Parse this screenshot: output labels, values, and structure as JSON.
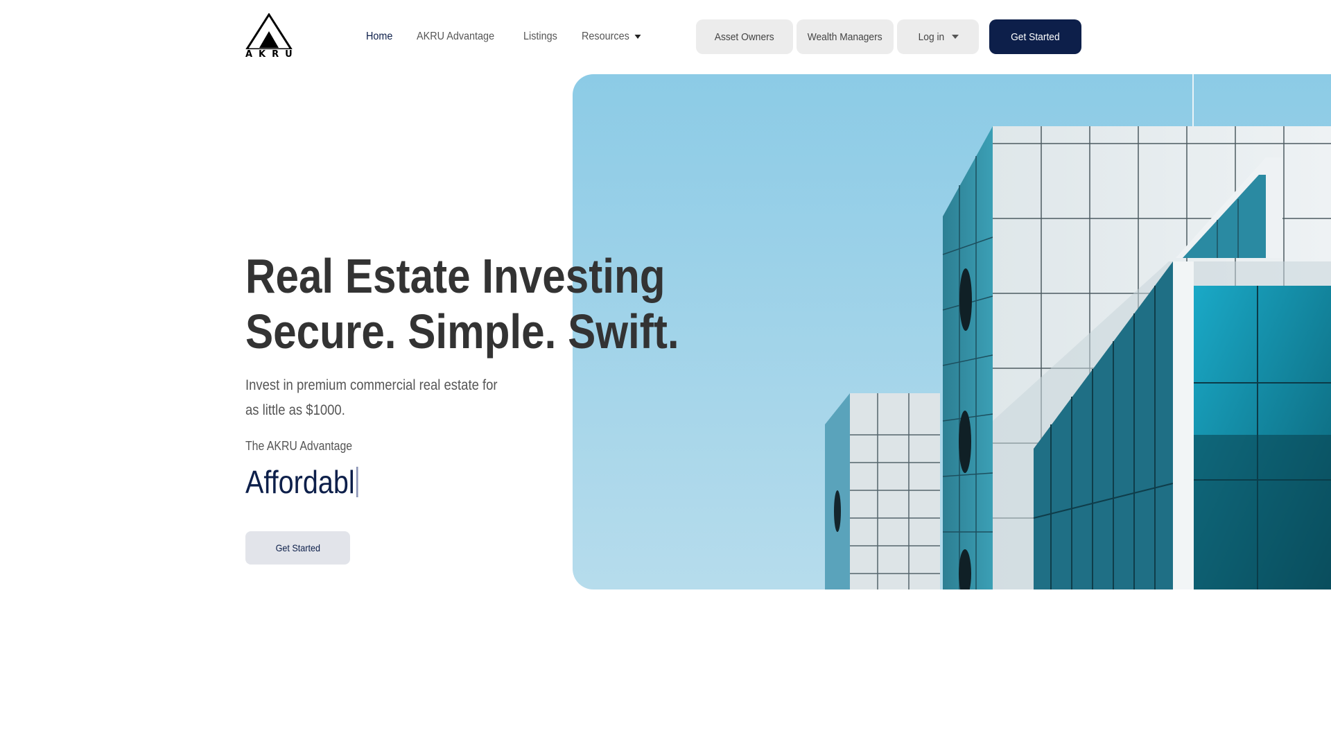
{
  "brand": {
    "name": "AKRU",
    "logo_icon": "triangle-logo-icon"
  },
  "nav": {
    "items": [
      {
        "label": "Home",
        "active": true
      },
      {
        "label": "AKRU Advantage",
        "active": false
      },
      {
        "label": "Listings",
        "active": false
      },
      {
        "label": "Resources",
        "active": false,
        "has_dropdown": true
      }
    ]
  },
  "header_actions": {
    "asset_owners": "Asset Owners",
    "wealth_managers": "Wealth Managers",
    "login": "Log in",
    "get_started": "Get Started"
  },
  "hero": {
    "headline_line1": "Real Estate Investing",
    "headline_line2": "Secure. Simple. Swift.",
    "subcopy": "Invest in premium commercial real estate for as little as $1000.",
    "advantage_label": "The AKRU Advantage",
    "typed_word": "Affordabl",
    "cta_label": "Get Started"
  },
  "colors": {
    "brand_navy": "#0d1f4a",
    "button_gray": "#ececec",
    "cta_gray": "#e2e4ea",
    "sky": "#9fd3ea"
  }
}
